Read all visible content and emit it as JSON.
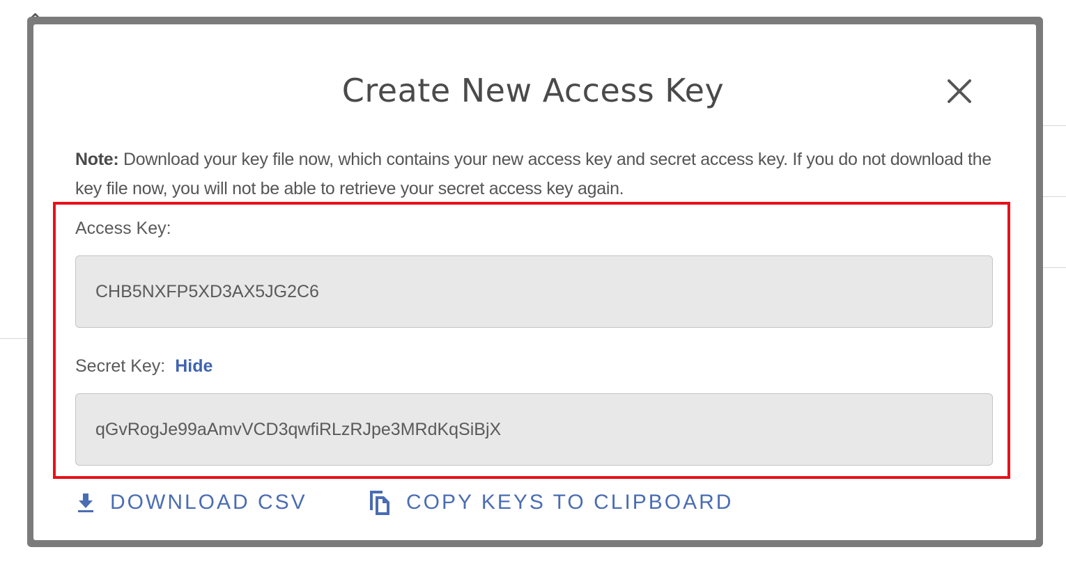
{
  "dialog": {
    "title": "Create New Access Key",
    "close_icon": "close-icon",
    "note_label": "Note:",
    "note_text": " Download your key file now, which contains your new access key and secret access key. If you do not download the key file now, you will not be able to retrieve your secret access key again."
  },
  "access_key": {
    "label": "Access Key:",
    "value": "CHB5NXFP5XD3AX5JG2C6"
  },
  "secret_key": {
    "label": "Secret Key:",
    "toggle_label": "Hide",
    "value": "qGvRogJe99aAmvVCD3qwfiRLzRJpe3MRdKqSiBjX"
  },
  "actions": {
    "download_label": "DOWNLOAD CSV",
    "download_icon": "download-icon",
    "copy_label": "COPY KEYS TO CLIPBOARD",
    "copy_icon": "copy-icon"
  },
  "colors": {
    "accent": "#4a6cb3",
    "highlight": "#e8101a",
    "field_bg": "#e8e8e8"
  }
}
